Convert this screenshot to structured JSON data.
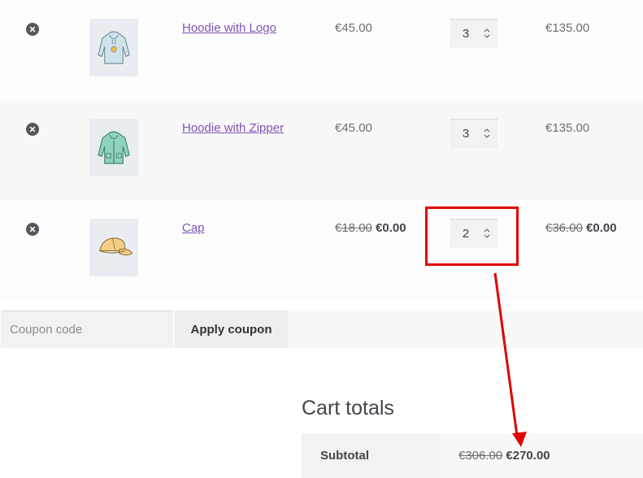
{
  "cart": {
    "items": [
      {
        "name": "Hoodie with Logo",
        "price": "€45.00",
        "quantity": "3",
        "subtotal": "€135.00",
        "image_icon": "hoodie-logo-icon"
      },
      {
        "name": "Hoodie with Zipper",
        "price": "€45.00",
        "quantity": "3",
        "subtotal": "€135.00",
        "image_icon": "hoodie-zipper-icon"
      },
      {
        "name": "Cap",
        "price_old": "€18.00",
        "price_new": "€0.00",
        "quantity": "2",
        "subtotal_old": "€36.00",
        "subtotal_new": "€0.00",
        "image_icon": "cap-icon"
      }
    ]
  },
  "coupon": {
    "placeholder": "Coupon code",
    "apply_label": "Apply coupon"
  },
  "totals": {
    "title": "Cart totals",
    "subtotal_label": "Subtotal",
    "subtotal_old": "€306.00",
    "subtotal_new": "€270.00"
  },
  "colors": {
    "link": "#7f54b3",
    "annotation": "#e00000"
  }
}
